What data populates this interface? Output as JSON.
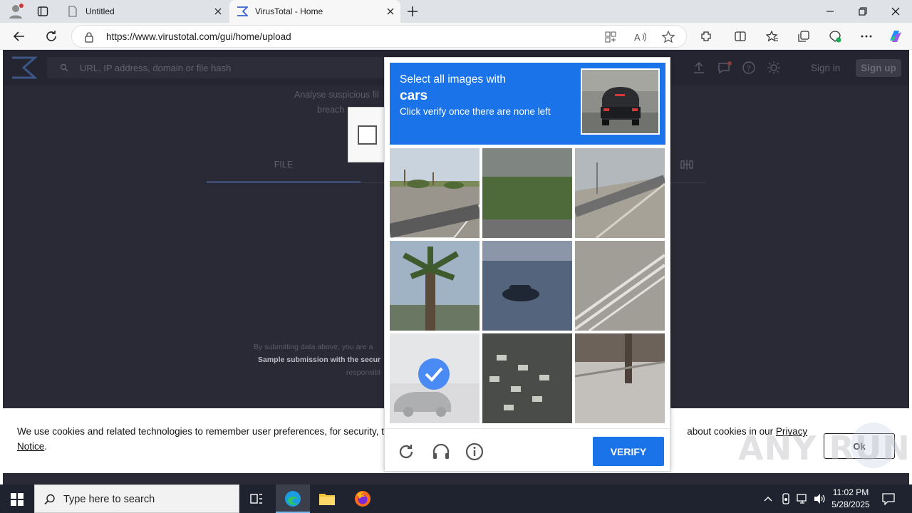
{
  "browser": {
    "tabs": [
      {
        "title": "Untitled",
        "icon": "document-icon"
      },
      {
        "title": "VirusTotal - Home",
        "icon": "virustotal-icon",
        "active": true
      }
    ],
    "url": "https://www.virustotal.com/gui/home/upload"
  },
  "virustotal": {
    "search_placeholder": "URL, IP address, domain or file hash",
    "sign_in": "Sign in",
    "sign_up": "Sign up",
    "analyse_line1": "Analyse suspicious fil",
    "analyse_line2": "breach",
    "tab_file": "FILE",
    "terms_line1": "By submitting data above, you are a",
    "terms_line2": "Sample submission with the secur",
    "terms_line3": "responsibl"
  },
  "captcha": {
    "line1": "Select all images with",
    "target": "cars",
    "line3": "Click verify once there are none left",
    "verify_label": "VERIFY",
    "tiles": [
      {
        "scene": "palm-trees-road",
        "selected": false
      },
      {
        "scene": "grass-noise",
        "selected": false
      },
      {
        "scene": "bridge-road",
        "selected": false
      },
      {
        "scene": "palm-tree",
        "selected": false
      },
      {
        "scene": "car-on-road",
        "selected": false
      },
      {
        "scene": "road-lines",
        "selected": false
      },
      {
        "scene": "parked-car",
        "selected": true
      },
      {
        "scene": "crosswalk",
        "selected": false
      },
      {
        "scene": "sidewalk",
        "selected": false
      }
    ]
  },
  "cookie": {
    "text_before": "We use cookies and related technologies to remember user preferences, for security, to",
    "text_after": "about cookies in our",
    "link": "Privacy Notice",
    "ok_label": "Ok"
  },
  "watermark": "ANY RUN",
  "taskbar": {
    "search_placeholder": "Type here to search",
    "time": "11:02 PM",
    "date": "5/28/2025"
  }
}
